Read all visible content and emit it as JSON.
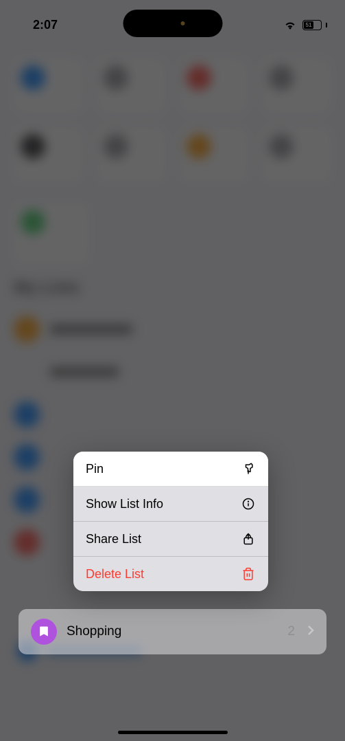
{
  "statusBar": {
    "time": "2:07",
    "batteryLevel": "51"
  },
  "contextMenu": {
    "items": [
      {
        "label": "Pin",
        "icon": "pin"
      },
      {
        "label": "Show List Info",
        "icon": "info"
      },
      {
        "label": "Share List",
        "icon": "share"
      },
      {
        "label": "Delete List",
        "icon": "trash"
      }
    ]
  },
  "listPreview": {
    "name": "Shopping",
    "count": "2",
    "iconColor": "#af52de"
  },
  "backgroundGrid": {
    "iconColors": [
      "#007aff",
      "#8e8e93",
      "#ff3b30",
      "#8e8e93",
      "#1c1c1e",
      "#8e8e93",
      "#ff9500",
      "#8e8e93"
    ]
  },
  "backgroundSection": {
    "title": "My Lists",
    "listColors": [
      "#ff9500",
      "#8e8e93",
      "#007aff",
      "#007aff",
      "#007aff",
      "#ff3b30"
    ]
  }
}
